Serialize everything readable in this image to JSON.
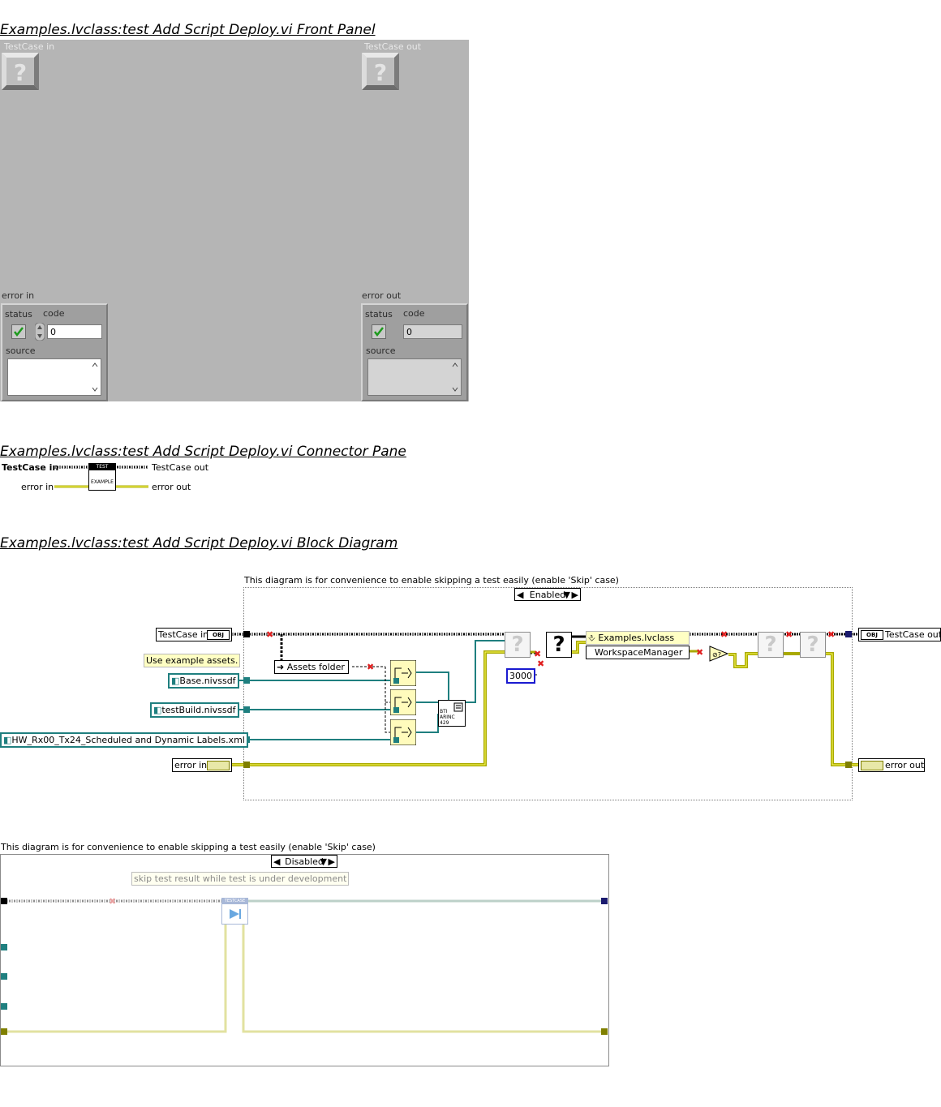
{
  "titles": {
    "front_panel": "Examples.lvclass:test Add Script Deploy.vi Front Panel",
    "connector_pane": "Examples.lvclass:test Add Script Deploy.vi Connector Pane",
    "block_diagram": "Examples.lvclass:test Add Script Deploy.vi Block Diagram"
  },
  "front_panel": {
    "testcase_in_label": "TestCase in",
    "testcase_out_label": "TestCase out",
    "error_in": {
      "label": "error in",
      "status": "status",
      "code": "code",
      "code_value": "0",
      "source": "source"
    },
    "error_out": {
      "label": "error out",
      "status": "status",
      "code": "code",
      "code_value": "0",
      "source": "source"
    }
  },
  "connector_pane": {
    "left": [
      "TestCase in",
      "error in"
    ],
    "right": [
      "TestCase out",
      "error out"
    ],
    "icon_top": "TEST",
    "icon_bottom": "EXAMPLE"
  },
  "block_diagram": {
    "enabled_case": {
      "comment": "This diagram is for convenience to enable skipping a test easily (enable 'Skip' case)",
      "selector": "Enabled",
      "testcase_in": "TestCase in",
      "testcase_out": "TestCase out",
      "use_example_assets": "Use example assets.",
      "base_file": "Base.nivssdf",
      "test_build_file": "testBuild.nivssdf",
      "labels_file": "HW_Rx00_Tx24_Scheduled and Dynamic Labels.xml",
      "error_in": "error in",
      "error_out": "error out",
      "assets_folder": "Assets folder",
      "timeout_constant": "3000",
      "class_name": "Examples.lvclass",
      "class_property": "WorkspaceManager",
      "arinc_text": "BTI ARINC 429"
    },
    "disabled_case": {
      "comment": "This diagram is for convenience to enable skipping a test easily (enable 'Skip' case)",
      "selector": "Disabled",
      "note": "skip test result while test is under development",
      "icon_label": "TESTCASE"
    }
  },
  "colors": {
    "panel_bg": "#b5b5b5",
    "path_wire": "#1f7f7f",
    "error_wire": "#c8c800",
    "class_wire": "#000000"
  }
}
